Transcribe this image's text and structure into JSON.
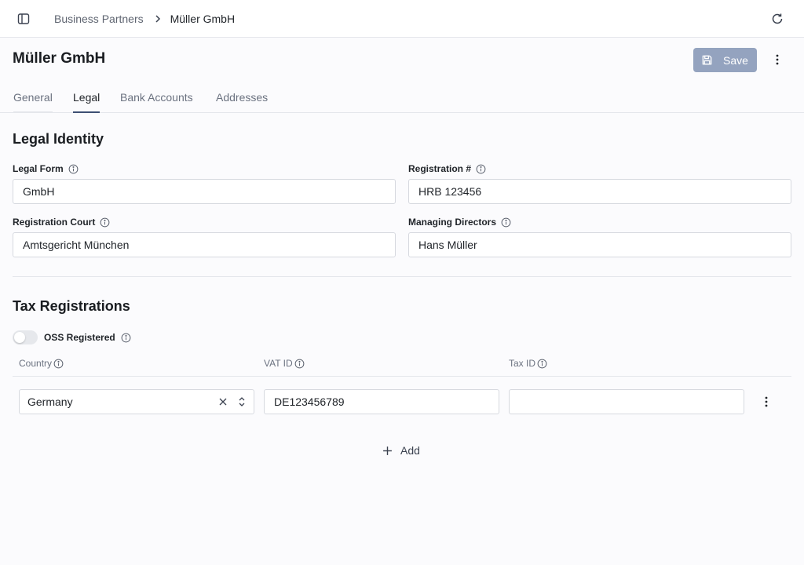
{
  "header": {
    "breadcrumb": [
      "Business Partners",
      "Müller GmbH"
    ]
  },
  "page": {
    "title": "Müller GmbH",
    "save_label": "Save"
  },
  "tabs": [
    "General",
    "Legal",
    "Bank Accounts",
    "Addresses"
  ],
  "active_tab": "Legal",
  "legal_identity": {
    "title": "Legal Identity",
    "legal_form": {
      "label": "Legal Form",
      "value": "GmbH"
    },
    "registration_no": {
      "label": "Registration #",
      "value": "HRB 123456"
    },
    "registration_court": {
      "label": "Registration Court",
      "value": "Amtsgericht München"
    },
    "managing_directors": {
      "label": "Managing Directors",
      "value": "Hans Müller"
    }
  },
  "tax": {
    "title": "Tax Registrations",
    "oss_label": "OSS Registered",
    "oss_enabled": false,
    "columns": [
      "Country",
      "VAT ID",
      "Tax ID"
    ],
    "rows": [
      {
        "country": "Germany",
        "vat_id": "DE123456789",
        "tax_id": ""
      }
    ],
    "add_label": "Add"
  },
  "colors": {
    "accent": "#3d4f73",
    "save_disabled": "#94a3bf",
    "border": "#d6d9df",
    "background": "#fbfbfd"
  },
  "icons": {
    "sidebar_toggle": "sidebar-icon",
    "refresh": "refresh-icon",
    "save": "floppy-disk-icon",
    "more": "vertical-dots-icon",
    "info": "info-circle-icon",
    "clear": "x-icon",
    "select": "chevron-up-down-icon",
    "add": "plus-icon"
  }
}
